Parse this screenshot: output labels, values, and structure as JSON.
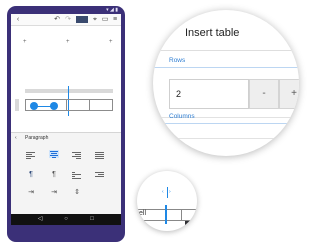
{
  "status_bar": {
    "icons": "▾ ◢ ▮"
  },
  "toolbar": {
    "back_icon": "chevron-left-icon",
    "undo_icon": "undo-icon",
    "redo_icon": "redo-icon",
    "format_icon": "format-icon",
    "brush_icon": "brush-icon",
    "comment_icon": "comment-icon",
    "menu_icon": "menu-icon",
    "back_glyph": "‹",
    "undo_glyph": "↶",
    "redo_glyph": "↷",
    "brush_glyph": "⌖",
    "comment_glyph": "▭",
    "menu_glyph": "≡"
  },
  "document": {
    "plus_glyph": "+"
  },
  "paragraph_panel": {
    "title": "Paragraph",
    "back_glyph": "‹",
    "glyph_pilcrow": "¶",
    "glyph_indent": "⇥",
    "glyph_spacing": "⇕"
  },
  "nav_bar": {
    "back": "◁",
    "home": "○",
    "recent": "□"
  },
  "dialog": {
    "back_glyph": "‹",
    "title": "Insert table",
    "rows_label": "Rows",
    "rows_value": "2",
    "minus_label": "-",
    "plus_label": "+",
    "columns_label": "Columns"
  },
  "small_lens": {
    "cell_text": "ell",
    "arrow_left": "‹",
    "arrow_right": "›"
  },
  "colors": {
    "phone": "#3b3078",
    "accent": "#1e88e5",
    "section_label": "#2d7dd2"
  }
}
